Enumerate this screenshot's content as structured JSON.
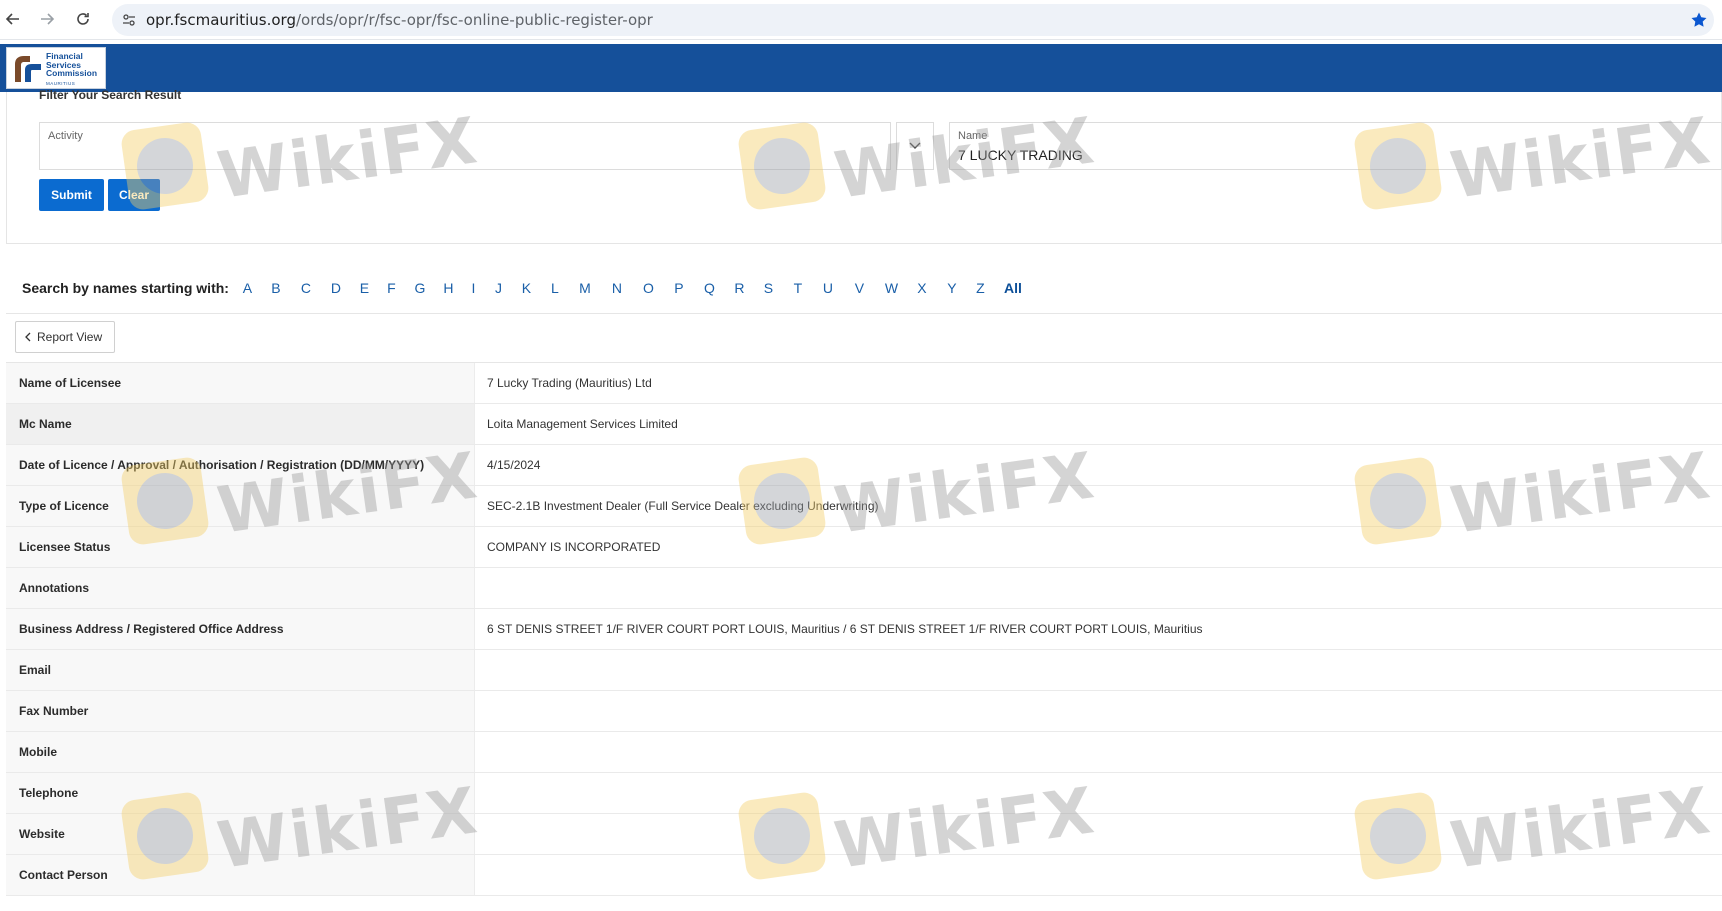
{
  "browser": {
    "url_host": "opr.fscmauritius.org",
    "url_path": "/ords/opr/r/fsc-opr/fsc-online-public-register-opr"
  },
  "header": {
    "logo_line1": "Financial",
    "logo_line2": "Services",
    "logo_line3": "Commission",
    "logo_sub": "MAURITIUS"
  },
  "filter": {
    "title": "Filter Your Search Result",
    "activity_label": "Activity",
    "activity_value": "",
    "name_label": "Name",
    "name_value": "7 LUCKY TRADING",
    "submit_label": "Submit",
    "clear_label": "Clear"
  },
  "letters": {
    "label": "Search by names starting with:",
    "items": [
      "A",
      "B",
      "C",
      "D",
      "E",
      "F",
      "G",
      "H",
      "I",
      "J",
      "K",
      "L",
      "M",
      "N",
      "O",
      "P",
      "Q",
      "R",
      "S",
      "T",
      "U",
      "V",
      "W",
      "X",
      "Y",
      "Z",
      "All"
    ]
  },
  "report": {
    "report_view_label": "Report View",
    "rows": [
      {
        "key": "Name of Licensee",
        "value": "7 Lucky Trading (Mauritius) Ltd"
      },
      {
        "key": "Mc Name",
        "value": "Loita Management Services Limited"
      },
      {
        "key": "Date of Licence / Approval / Authorisation / Registration (DD/MM/YYYY)",
        "value": "4/15/2024"
      },
      {
        "key": "Type of Licence",
        "value": "SEC-2.1B Investment Dealer (Full Service Dealer excluding Underwriting)"
      },
      {
        "key": "Licensee Status",
        "value": "COMPANY IS INCORPORATED"
      },
      {
        "key": "Annotations",
        "value": ""
      },
      {
        "key": "Business Address / Registered Office Address",
        "value": "6 ST DENIS STREET 1/F RIVER COURT PORT LOUIS, Mauritius / 6 ST DENIS STREET 1/F RIVER COURT PORT LOUIS, Mauritius"
      },
      {
        "key": "Email",
        "value": ""
      },
      {
        "key": "Fax Number",
        "value": ""
      },
      {
        "key": "Mobile",
        "value": ""
      },
      {
        "key": "Telephone",
        "value": ""
      },
      {
        "key": "Website",
        "value": ""
      },
      {
        "key": "Contact Person",
        "value": ""
      }
    ]
  },
  "watermark": {
    "text": "WikiFX"
  },
  "colors": {
    "header_blue": "#15509a",
    "button_blue": "#0b6bd0",
    "link_blue": "#1a5fa8"
  }
}
